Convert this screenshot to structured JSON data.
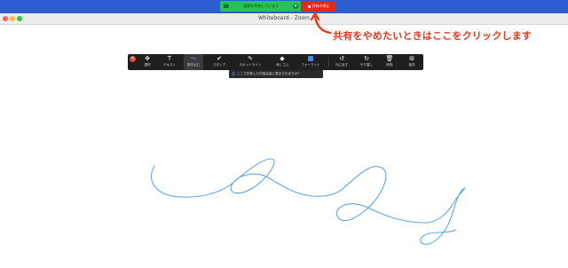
{
  "share_bar": {
    "sharing_label": "画面を共有しています",
    "stop_label": "共有の停止",
    "accent_color": "#2d5ed1",
    "sharing_color": "#27c15a",
    "stop_color": "#e02a1a"
  },
  "window": {
    "title": "Whiteboard - Zoom"
  },
  "annotation": {
    "text": "共有をやめたいときはここをクリックします",
    "color": "#e8361a"
  },
  "toolbar": {
    "tools": [
      {
        "icon": "move-icon",
        "glyph": "✥",
        "label": "選択"
      },
      {
        "icon": "text-icon",
        "glyph": "T",
        "label": "テキスト"
      },
      {
        "icon": "draw-icon",
        "glyph": "〜",
        "label": "描き込む"
      },
      {
        "icon": "stamp-icon",
        "glyph": "✔",
        "label": "スタンプ"
      },
      {
        "icon": "spotlight-icon",
        "glyph": "✎",
        "label": "スポットライト"
      },
      {
        "icon": "eraser-icon",
        "glyph": "◆",
        "label": "消しゴム"
      },
      {
        "icon": "format-icon",
        "glyph": "",
        "label": "フォーマット"
      },
      {
        "icon": "undo-icon",
        "glyph": "↺",
        "label": "元に戻す"
      },
      {
        "icon": "redo-icon",
        "glyph": "↻",
        "label": "やり直し"
      },
      {
        "icon": "trash-icon",
        "glyph": "🗑",
        "label": "削除"
      },
      {
        "icon": "save-icon",
        "glyph": "⊞",
        "label": "保存"
      }
    ],
    "active_tool": "描き込む",
    "format_color": "#3d8cf0"
  },
  "tooltip": {
    "text": "ここで共有した内容は皆に表示されますか?"
  },
  "drawing": {
    "stroke_color": "#5ea8e0"
  }
}
